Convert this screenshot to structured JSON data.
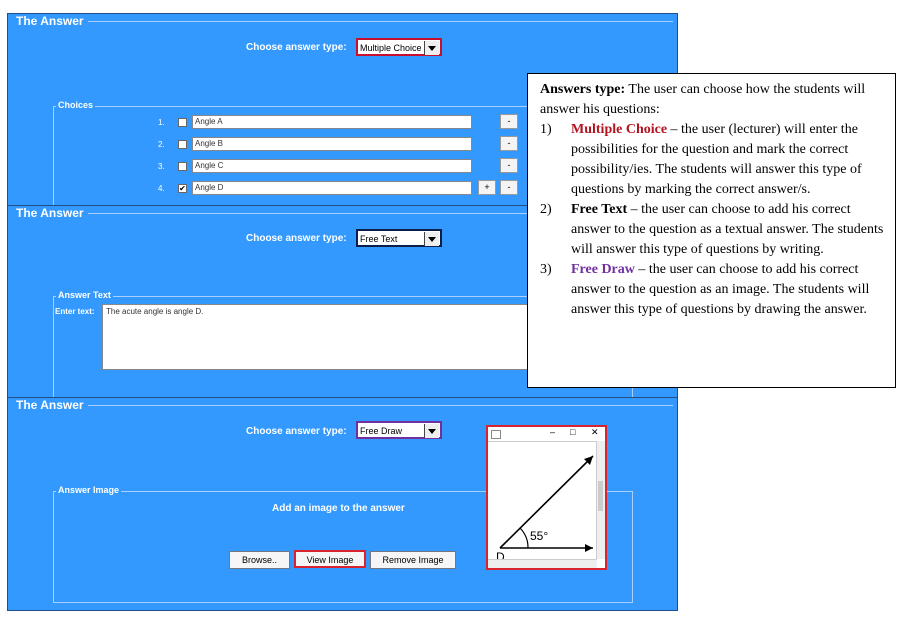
{
  "panel_title": "The Answer",
  "choose_label": "Choose answer type:",
  "panel1": {
    "combo_value": "Multiple Choice",
    "group_title": "Choices",
    "choices": [
      {
        "num": "1.",
        "text": "Angle A",
        "checked": false,
        "check_mark": ""
      },
      {
        "num": "2.",
        "text": "Angle B",
        "checked": false,
        "check_mark": ""
      },
      {
        "num": "3.",
        "text": "Angle C",
        "checked": false,
        "check_mark": ""
      },
      {
        "num": "4.",
        "text": "Angle D",
        "checked": true,
        "check_mark": "✔"
      }
    ],
    "minus_label": "-",
    "plus_label": "+"
  },
  "panel2": {
    "combo_value": "Free Text",
    "group_title": "Answer Text",
    "enter_label": "Enter text:",
    "text_value": "The acute angle is angle D."
  },
  "panel3": {
    "combo_value": "Free Draw",
    "group_title": "Answer Image",
    "add_image_label": "Add an image to the answer",
    "browse_label": "Browse..",
    "view_label": "View Image",
    "remove_label": "Remove Image",
    "window": {
      "minimize": "–",
      "maximize": "□",
      "close": "✕",
      "angle_label": "55°",
      "vertex_label": "D"
    }
  },
  "callout": {
    "title": "Answers type:",
    "intro": "The user can choose how the students will answer his questions:",
    "items": [
      {
        "num": "1)",
        "term": "Multiple Choice",
        "desc": " – the user (lecturer) will enter the possibilities for the question and mark the correct possibility/ies. The students will answer this type of questions by marking the correct answer/s."
      },
      {
        "num": "2)",
        "term": "Free Text",
        "desc": " – the user can choose to add his correct answer to the question as a textual answer. The students will answer this type of questions by writing."
      },
      {
        "num": "3)",
        "term": "Free Draw",
        "desc": " – the user can choose to add his correct answer to the question as an image. The students will answer this type of questions by drawing the answer."
      }
    ]
  },
  "colors": {
    "panel_bg": "#3399ff",
    "multiple_choice": "#b3121f",
    "free_text": "#000000",
    "free_draw": "#7030a0",
    "combo_border_mc": "#c8102e",
    "combo_border_ft": "#0b1f4a",
    "combo_border_fd": "#7030a0",
    "view_border": "#d9232d"
  }
}
